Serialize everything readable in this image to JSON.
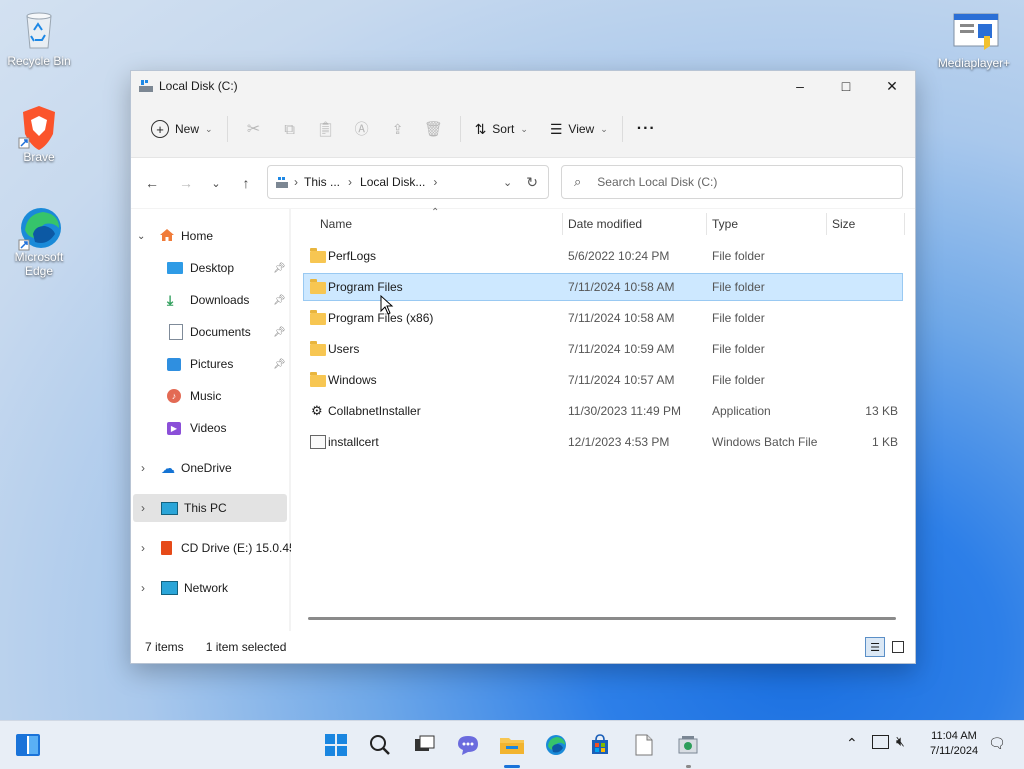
{
  "desktop": {
    "icons": [
      {
        "label": "Recycle Bin",
        "icon": "recycle-bin-icon"
      },
      {
        "label": "Brave",
        "icon": "brave-icon"
      },
      {
        "label": "Microsoft Edge",
        "icon": "edge-icon"
      },
      {
        "label": "Mediaplayer+",
        "icon": "mediaplayer-icon"
      }
    ]
  },
  "window": {
    "title": "Local Disk (C:)",
    "controls": {
      "minimize": "–",
      "maximize": "□",
      "close": "✕"
    }
  },
  "toolbar": {
    "new_label": "New",
    "sort_label": "Sort",
    "view_label": "View",
    "more_label": "···"
  },
  "address": {
    "crumbs": [
      "This ...",
      "Local Disk..."
    ],
    "search_placeholder": "Search Local Disk (C:)"
  },
  "sidebar": {
    "home": "Home",
    "quick": [
      {
        "label": "Desktop",
        "pinned": true
      },
      {
        "label": "Downloads",
        "pinned": true
      },
      {
        "label": "Documents",
        "pinned": true
      },
      {
        "label": "Pictures",
        "pinned": true
      },
      {
        "label": "Music",
        "pinned": false
      },
      {
        "label": "Videos",
        "pinned": false
      }
    ],
    "onedrive": "OneDrive",
    "this_pc": "This PC",
    "cd_drive": "CD Drive (E:) 15.0.45",
    "network": "Network"
  },
  "columns": {
    "name": "Name",
    "date": "Date modified",
    "type": "Type",
    "size": "Size"
  },
  "files": [
    {
      "name": "PerfLogs",
      "date": "5/6/2022 10:24 PM",
      "type": "File folder",
      "size": "",
      "kind": "folder"
    },
    {
      "name": "Program Files",
      "date": "7/11/2024 10:58 AM",
      "type": "File folder",
      "size": "",
      "kind": "folder",
      "selected": true
    },
    {
      "name": "Program Files (x86)",
      "date": "7/11/2024 10:58 AM",
      "type": "File folder",
      "size": "",
      "kind": "folder"
    },
    {
      "name": "Users",
      "date": "7/11/2024 10:59 AM",
      "type": "File folder",
      "size": "",
      "kind": "folder"
    },
    {
      "name": "Windows",
      "date": "7/11/2024 10:57 AM",
      "type": "File folder",
      "size": "",
      "kind": "folder"
    },
    {
      "name": "CollabnetInstaller",
      "date": "11/30/2023 11:49 PM",
      "type": "Application",
      "size": "13 KB",
      "kind": "app"
    },
    {
      "name": "installcert",
      "date": "12/1/2023 4:53 PM",
      "type": "Windows Batch File",
      "size": "1 KB",
      "kind": "bat"
    }
  ],
  "status": {
    "items": "7 items",
    "selected": "1 item selected"
  },
  "taskbar": {
    "time": "11:04 AM",
    "date": "7/11/2024"
  }
}
